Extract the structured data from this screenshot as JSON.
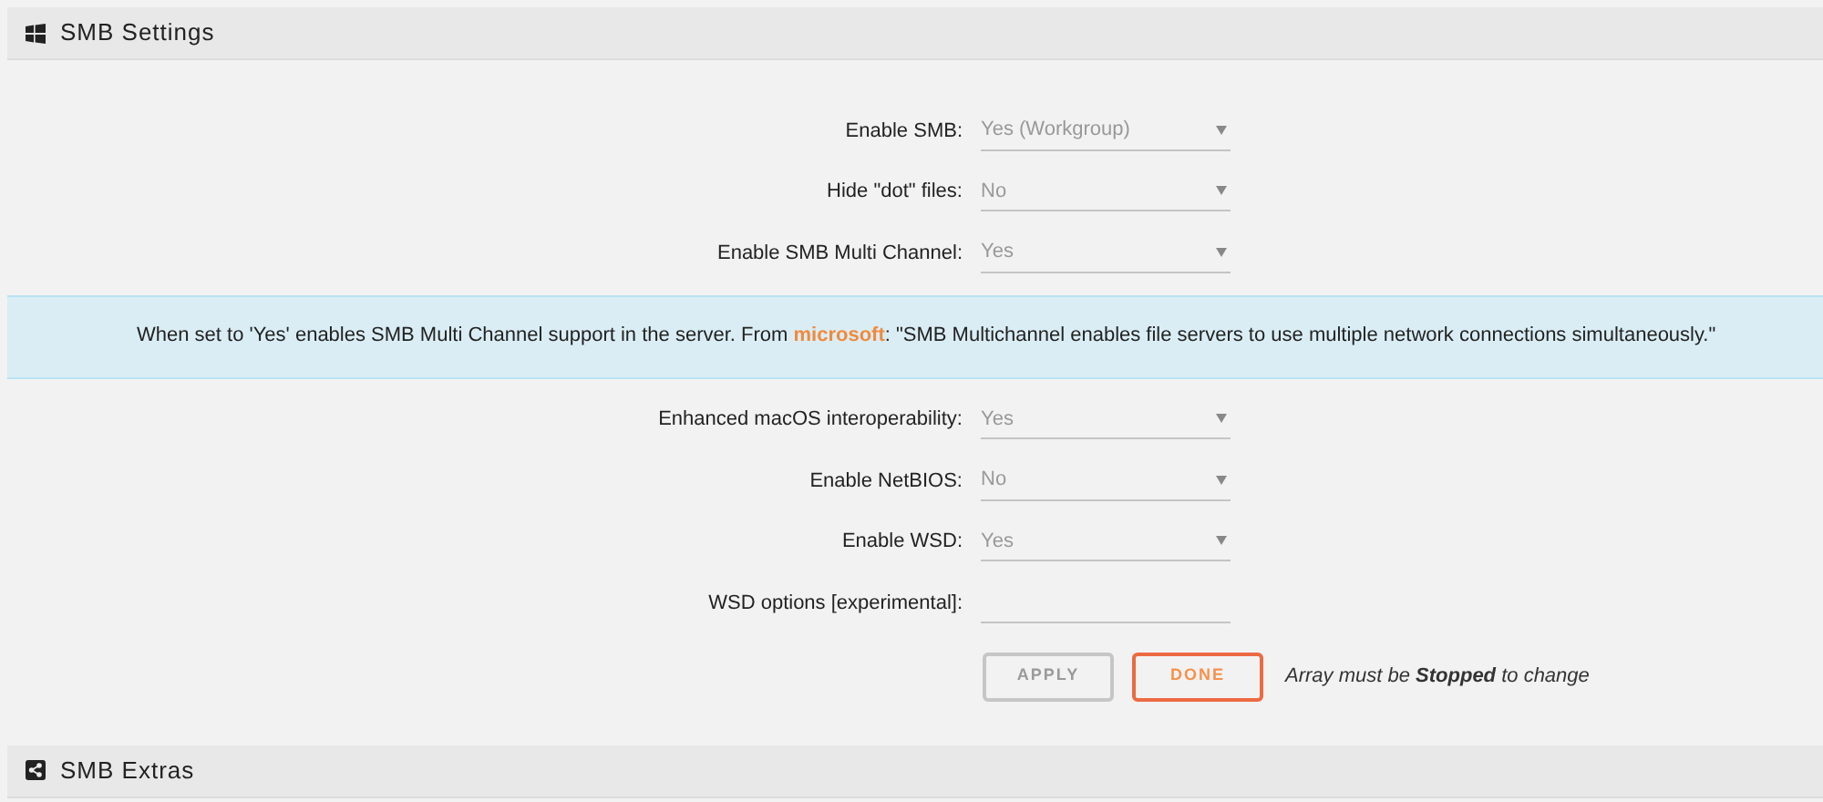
{
  "sections": [
    {
      "title": "SMB Settings"
    },
    {
      "title": "SMB Extras"
    }
  ],
  "settings": [
    {
      "kind": "select",
      "label": "Enable SMB:",
      "value": "Yes (Workgroup)"
    },
    {
      "kind": "select",
      "label": "Hide \"dot\" files:",
      "value": "No"
    },
    {
      "kind": "select",
      "label": "Enable SMB Multi Channel:",
      "value": "Yes"
    },
    {
      "kind": "info",
      "before": "When set to 'Yes' enables SMB Multi Channel support in the server. From",
      "link": "microsoft",
      "after": ": \"SMB Multichannel enables file servers to use multiple network connections simultaneously.\""
    },
    {
      "kind": "select",
      "label": "Enhanced macOS interoperability:",
      "value": "Yes"
    },
    {
      "kind": "select",
      "label": "Enable NetBIOS:",
      "value": "No"
    },
    {
      "kind": "select",
      "label": "Enable WSD:",
      "value": "Yes"
    },
    {
      "kind": "input",
      "label": "WSD options [experimental]:"
    }
  ],
  "buttons": [
    {
      "label": "APPLY",
      "disabled": true
    },
    {
      "label": "DONE",
      "disabled": false
    }
  ],
  "note": "Array must be **Stopped** to change"
}
